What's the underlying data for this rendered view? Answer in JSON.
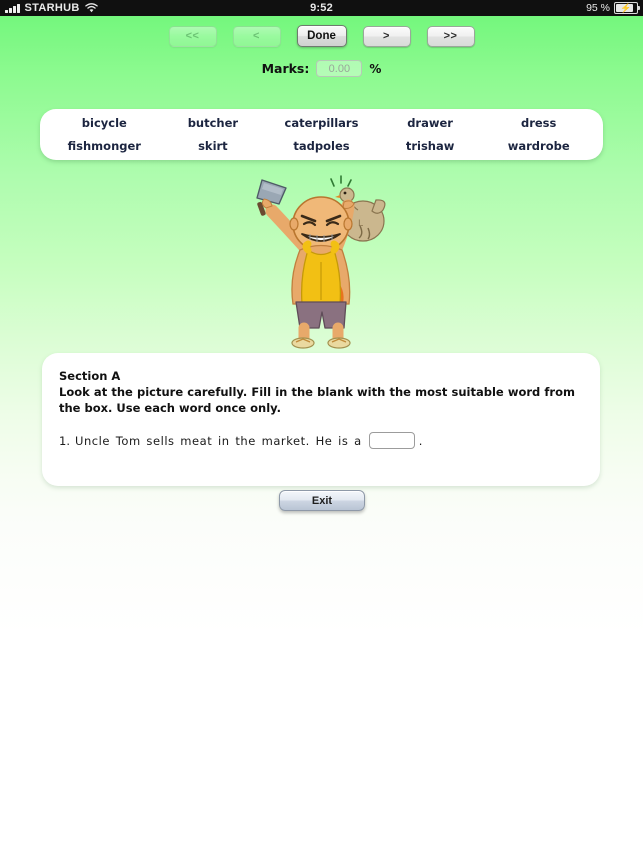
{
  "status_bar": {
    "carrier": "STARHUB",
    "signal_icon": "signal-bars-icon",
    "wifi_icon": "wifi-icon",
    "time": "9:52",
    "battery_percent": "95 %",
    "battery_icon": "battery-charging-icon"
  },
  "toolbar": {
    "first_label": "<<",
    "prev_label": "<",
    "done_label": "Done",
    "next_label": ">",
    "last_label": ">>"
  },
  "marks": {
    "label": "Marks:",
    "value": "",
    "placeholder": "0.00",
    "suffix": "%"
  },
  "word_bank": {
    "words": [
      "bicycle",
      "butcher",
      "caterpillars",
      "drawer",
      "dress",
      "fishmonger",
      "skirt",
      "tadpoles",
      "trishaw",
      "wardrobe"
    ]
  },
  "illustration": {
    "name": "butcher-cartoon-illustration",
    "alt": "Cartoon butcher holding a meat cleaver and a chicken"
  },
  "section": {
    "title": "Section A",
    "instructions": "Look at the picture carefully. Fill in the blank with the most suitable word from the box. Use each word once only.",
    "question_number": "1.",
    "question_text": "Uncle Tom sells meat in the market. He is a",
    "answer_value": "",
    "question_period": "."
  },
  "footer": {
    "exit_label": "Exit"
  },
  "colors": {
    "background_top": "#74f77d",
    "background_bottom": "#ffffff",
    "word_text": "#1c2540",
    "card_background": "#ffffff",
    "status_bar": "#101010"
  }
}
